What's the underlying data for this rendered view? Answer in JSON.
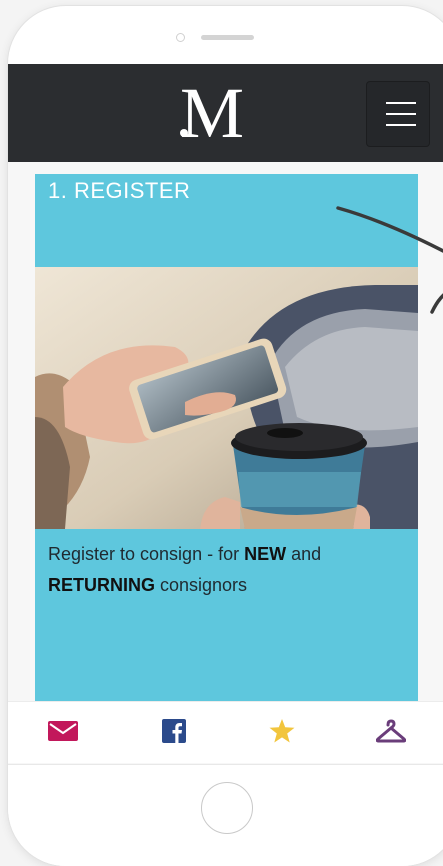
{
  "header": {
    "logo_text": "M",
    "menu_icon": "hamburger-menu-icon"
  },
  "card": {
    "title": "1. REGISTER",
    "description": {
      "part1": "Register to consign - for ",
      "bold1": "NEW",
      "part2": " and ",
      "bold2": "RETURNING",
      "part3": " consignors"
    },
    "photo": "hands-holding-phone-and-coffee-cup",
    "background_color": "#5ec7dd"
  },
  "bottom_nav": {
    "items": [
      {
        "icon": "mail-icon",
        "color": "#c2185b"
      },
      {
        "icon": "facebook-icon",
        "color": "#2b4a8b"
      },
      {
        "icon": "star-icon",
        "color": "#f2c53d"
      },
      {
        "icon": "hanger-icon",
        "color": "#6a3d7a"
      }
    ]
  }
}
